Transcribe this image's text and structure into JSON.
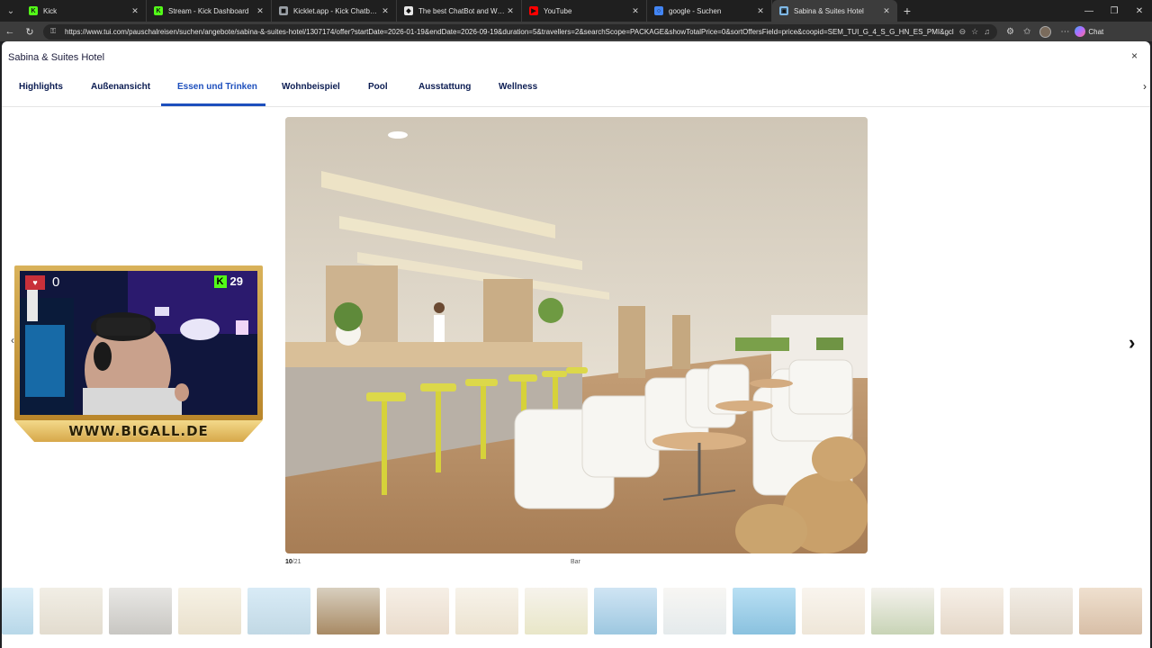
{
  "browser": {
    "tabs": [
      {
        "title": "Kick",
        "favicon_color": "#53fc18",
        "favicon_glyph": "K"
      },
      {
        "title": "Stream - Kick Dashboard",
        "favicon_color": "#53fc18",
        "favicon_glyph": "K"
      },
      {
        "title": "Kicklet.app - Kick Chatbot and Ov",
        "favicon_color": "#9aa0a6",
        "favicon_glyph": "◼"
      },
      {
        "title": "The best ChatBot and Widgets fo",
        "favicon_color": "#e8e8e8",
        "favicon_glyph": "◆"
      },
      {
        "title": "YouTube",
        "favicon_color": "#ff0000",
        "favicon_glyph": "▶"
      },
      {
        "title": "google - Suchen",
        "favicon_color": "#4285f4",
        "favicon_glyph": "○"
      },
      {
        "title": "Sabina & Suites Hotel",
        "favicon_color": "#7fb8e6",
        "favicon_glyph": "▣",
        "active": true
      }
    ],
    "url": "https://www.tui.com/pauschalreisen/suchen/angebote/sabina-&-suites-hotel/1307174/offer?startDate=2026-01-19&endDate=2026-09-19&duration=5&travellers=2&searchScope=PACKAGE&showTotalPrice=0&sortOffersField=price&coopid=SEM_TUI_G_4_S_G_HN_ES_PMI&gclsrc=a...",
    "chat_label": "Chat"
  },
  "modal": {
    "title": "Sabina & Suites Hotel",
    "tabs": [
      "Highlights",
      "Außenansicht",
      "Essen und Trinken",
      "Wohnbeispiel",
      "Pool",
      "Ausstattung",
      "Wellness"
    ],
    "active_tab": "Essen und Trinken",
    "counter_current": "10",
    "counter_total": "/21",
    "caption": "Bar"
  },
  "overlay": {
    "left_count": "0",
    "right_count": "29",
    "banner": "WWW.BIGALL.DE",
    "k_glyph": "K"
  }
}
